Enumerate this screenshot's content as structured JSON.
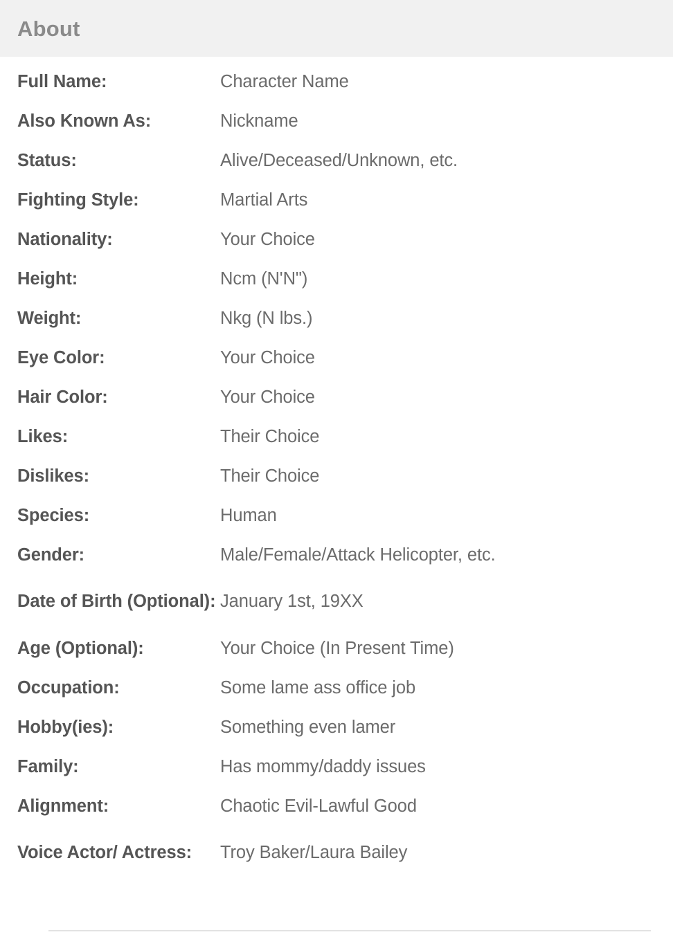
{
  "header": {
    "title": "About",
    "background_color": "#f1f1f1",
    "text_color": "#8a8a8a"
  },
  "colors": {
    "page_background": "#ffffff",
    "label_text": "#555555",
    "value_text": "#6b6b6b",
    "divider": "#e2e2e2"
  },
  "about": {
    "rows": [
      {
        "label": "Full Name:",
        "value": "Character Name",
        "tall": false
      },
      {
        "label": "Also Known As:",
        "value": "Nickname",
        "tall": false
      },
      {
        "label": "Status:",
        "value": "Alive/Deceased/Unknown, etc.",
        "tall": false
      },
      {
        "label": "Fighting Style:",
        "value": "Martial Arts",
        "tall": false
      },
      {
        "label": "Nationality:",
        "value": "Your Choice",
        "tall": false
      },
      {
        "label": "Height:",
        "value": "Ncm (N'N\")",
        "tall": false
      },
      {
        "label": "Weight:",
        "value": "Nkg (N lbs.)",
        "tall": false
      },
      {
        "label": "Eye Color:",
        "value": "Your Choice",
        "tall": false
      },
      {
        "label": "Hair Color:",
        "value": "Your Choice",
        "tall": false
      },
      {
        "label": "Likes:",
        "value": "Their Choice",
        "tall": false
      },
      {
        "label": "Dislikes:",
        "value": "Their Choice",
        "tall": false
      },
      {
        "label": "Species:",
        "value": "Human",
        "tall": false
      },
      {
        "label": "Gender:",
        "value": "Male/Female/Attack Helicopter, etc.",
        "tall": false
      },
      {
        "label": "Date of Birth (Optional):",
        "value": "January 1st, 19XX",
        "tall": true
      },
      {
        "label": "Age (Optional):",
        "value": "Your Choice (In Present Time)",
        "tall": false
      },
      {
        "label": "Occupation:",
        "value": "Some lame ass office job",
        "tall": false
      },
      {
        "label": "Hobby(ies):",
        "value": "Something even lamer",
        "tall": false
      },
      {
        "label": "Family:",
        "value": "Has mommy/daddy issues",
        "tall": false
      },
      {
        "label": "Alignment:",
        "value": "Chaotic Evil-Lawful Good",
        "tall": false
      },
      {
        "label": "Voice Actor/ Actress:",
        "value": "Troy Baker/Laura Bailey",
        "tall": true
      }
    ]
  }
}
